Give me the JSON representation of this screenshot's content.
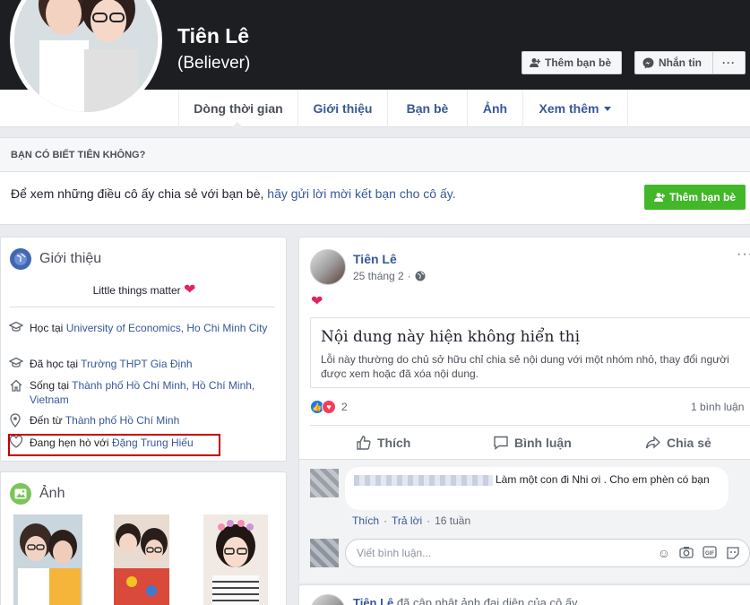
{
  "profile": {
    "name": "Tiên Lê",
    "alternate_name": "(Believer)",
    "add_friend_label": "Thêm bạn bè",
    "message_label": "Nhắn tin",
    "more_label": "···"
  },
  "tabs": [
    {
      "label": "Dòng thời gian"
    },
    {
      "label": "Giới thiệu"
    },
    {
      "label": "Bạn bè"
    },
    {
      "label": "Ảnh"
    },
    {
      "label": "Xem thêm"
    }
  ],
  "know_box": {
    "heading": "BẠN CÓ BIẾT TIÊN KHÔNG?",
    "text_prefix": "Để xem những điều cô ấy chia sẻ với bạn bè, ",
    "text_link": "hãy gửi lời mời kết bạn cho cô ấy.",
    "button_label": "Thêm bạn bè"
  },
  "intro": {
    "title": "Giới thiệu",
    "motto": "Little things matter",
    "items": [
      {
        "icon": "graduation-cap-icon",
        "prefix": "Học tại ",
        "link": "University of Economics, Ho Chi Minh City"
      },
      {
        "icon": "graduation-cap-icon",
        "prefix": "Đã học tại ",
        "link": "Trường THPT Gia Định"
      },
      {
        "icon": "home-icon",
        "prefix": "Sống tại ",
        "link": "Thành phố Hồ Chí Minh, Hồ Chí Minh, Vietnam"
      },
      {
        "icon": "location-pin-icon",
        "prefix": "Đến từ ",
        "link": "Thành phố Hồ Chí Minh"
      },
      {
        "icon": "heart-outline-icon",
        "prefix": "Đang hẹn hò với ",
        "link": "Đặng Trung Hiếu"
      }
    ]
  },
  "photos": {
    "title": "Ảnh"
  },
  "post": {
    "author": "Tiên Lê",
    "date": "25 tháng 2",
    "separator": "·",
    "emoji": "❤",
    "hidden_title": "Nội dung này hiện không hiển thị",
    "hidden_desc": "Lỗi này thường do chủ sở hữu chỉ chia sẻ nội dung với một nhóm nhỏ, thay đổi người được xem hoặc đã xóa nội dung.",
    "reaction_count": "2",
    "comment_count": "1 bình luận",
    "actions": {
      "like": "Thích",
      "comment": "Bình luận",
      "share": "Chia sẻ"
    },
    "comment": {
      "text": "Làm một con đi Nhi ơi . Cho em phèn có bạn",
      "like": "Thích",
      "dot": "·",
      "reply": "Trả lời",
      "time": "16 tuần"
    },
    "write_placeholder": "Viết bình luận..."
  },
  "post2": {
    "author": "Tiên Lê",
    "action": " đã cập nhật ảnh đại diện của cô ấy."
  },
  "colors": {
    "link": "#365899",
    "green": "#42b72a",
    "highlight_box": "#c70000"
  }
}
